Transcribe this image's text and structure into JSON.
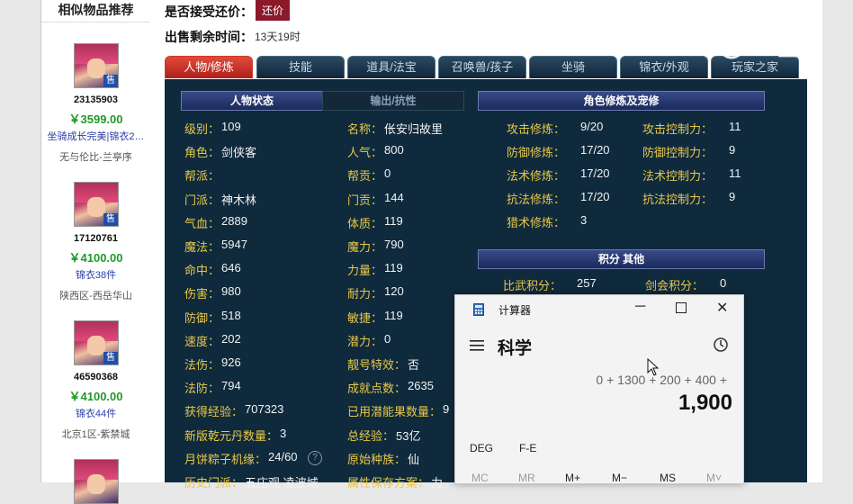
{
  "sidebar": {
    "title": "相似物品推荐",
    "items": [
      {
        "id": "23135903",
        "price": "￥3599.00",
        "tag": "坐骑成长完美|锦衣2…",
        "server": "无与伦比-兰亭序",
        "badge": "售"
      },
      {
        "id": "17120761",
        "price": "￥4100.00",
        "tag": "锦衣38件",
        "server": "陕西区-西岳华山",
        "badge": "售"
      },
      {
        "id": "46590368",
        "price": "￥4100.00",
        "tag": "锦衣44件",
        "server": "北京1区-紫禁城",
        "badge": "售"
      }
    ]
  },
  "header": {
    "bargain_label": "是否接受还价：",
    "bargain_button": "还价",
    "remaining_label": "出售剩余时间：",
    "remaining_value": "13天19时"
  },
  "tabs": [
    "人物/修炼",
    "技能",
    "道具/法宝",
    "召唤兽/孩子",
    "坐骑",
    "锦衣/外观",
    "玩家之家"
  ],
  "subtabs": {
    "status": "人物状态",
    "output": "输出/抗性",
    "cultivation": "角色修炼及宠修",
    "points": "积分 其他"
  },
  "stats_left": [
    {
      "label": "级别：",
      "value": "109"
    },
    {
      "label": "角色：",
      "value": "剑侠客"
    },
    {
      "label": "帮派：",
      "value": ""
    },
    {
      "label": "门派：",
      "value": "神木林"
    },
    {
      "label": "气血：",
      "value": "2889"
    },
    {
      "label": "魔法：",
      "value": "5947"
    },
    {
      "label": "命中：",
      "value": "646"
    },
    {
      "label": "伤害：",
      "value": "980"
    },
    {
      "label": "防御：",
      "value": "518"
    },
    {
      "label": "速度：",
      "value": "202"
    },
    {
      "label": "法伤：",
      "value": "926"
    },
    {
      "label": "法防：",
      "value": "794"
    },
    {
      "label": "获得经验：",
      "value": "707323"
    },
    {
      "label": "新版乾元丹数量：",
      "value": "3"
    },
    {
      "label": "月饼粽子机缘：",
      "value": "24/60"
    },
    {
      "label": "历史门派：",
      "value": "五庄观 凌波城"
    }
  ],
  "stats_mid": [
    {
      "label": "名称：",
      "value": "伥安归故里"
    },
    {
      "label": "人气：",
      "value": "800"
    },
    {
      "label": "帮贡：",
      "value": "0"
    },
    {
      "label": "门贡：",
      "value": "144"
    },
    {
      "label": "体质：",
      "value": "119"
    },
    {
      "label": "魔力：",
      "value": "790"
    },
    {
      "label": "力量：",
      "value": "119"
    },
    {
      "label": "耐力：",
      "value": "120"
    },
    {
      "label": "敏捷：",
      "value": "119"
    },
    {
      "label": "潜力：",
      "value": "0"
    },
    {
      "label": "靓号特效：",
      "value": "否"
    },
    {
      "label": "成就点数：",
      "value": "2635"
    },
    {
      "label": "已用潜能果数量：",
      "value": "9"
    },
    {
      "label": "总经验：",
      "value": "53亿"
    },
    {
      "label": "原始种族：",
      "value": "仙"
    },
    {
      "label": "属性保存方案：",
      "value": "力"
    }
  ],
  "cultivation": [
    {
      "label": "攻击修炼：",
      "value": "9/20",
      "label2": "攻击控制力：",
      "value2": "11"
    },
    {
      "label": "防御修炼：",
      "value": "17/20",
      "label2": "防御控制力：",
      "value2": "9"
    },
    {
      "label": "法术修炼：",
      "value": "17/20",
      "label2": "法术控制力：",
      "value2": "11"
    },
    {
      "label": "抗法修炼：",
      "value": "17/20",
      "label2": "抗法控制力：",
      "value2": "9"
    },
    {
      "label": "猎术修炼：",
      "value": "3",
      "label2": "",
      "value2": ""
    }
  ],
  "points": {
    "label1": "比武积分：",
    "value1": "257",
    "label2": "剑会积分：",
    "value2": "0"
  },
  "calculator": {
    "title": "计算器",
    "mode": "科学",
    "expression": "0 + 1300 + 200 + 400 +",
    "result": "1,900",
    "row1": [
      "DEG",
      "F-E"
    ],
    "row2": [
      "MC",
      "MR",
      "M+",
      "M−",
      "MS",
      "M˅"
    ]
  },
  "watermark": "CC直播",
  "colors": {
    "label": "#e8c84a",
    "panel_bg": "#0f2a3c",
    "price": "#1f9a2a",
    "active_tab": "#c8302a"
  }
}
